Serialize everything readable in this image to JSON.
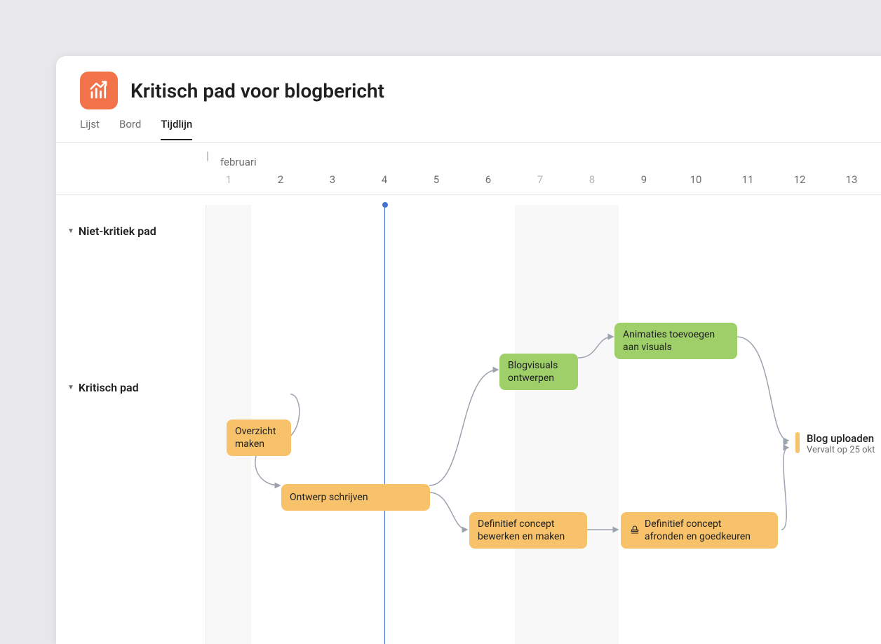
{
  "header": {
    "title": "Kritisch pad voor blogbericht",
    "icon": "growth-chart-icon",
    "accent_color": "#f2734a"
  },
  "tabs": {
    "items": [
      {
        "label": "Lijst",
        "id": "list"
      },
      {
        "label": "Bord",
        "id": "board"
      },
      {
        "label": "Tijdlijn",
        "id": "timeline"
      }
    ],
    "active": "timeline"
  },
  "timeline": {
    "month_label": "februari",
    "today_index": 4,
    "days": [
      1,
      2,
      3,
      4,
      5,
      6,
      7,
      8,
      9,
      10,
      11,
      12,
      13
    ],
    "weekends": [
      [
        1,
        1
      ],
      [
        7,
        8
      ]
    ]
  },
  "sections": [
    {
      "id": "noncritical",
      "label": "Niet-kritiek pad"
    },
    {
      "id": "critical",
      "label": "Kritisch pad"
    }
  ],
  "tasks": {
    "overzicht": {
      "label": "Overzicht\nmaken",
      "color": "orange"
    },
    "ontwerp": {
      "label": "Ontwerp schrijven",
      "color": "orange"
    },
    "blogvisuals": {
      "label": "Blogvisuals\nontwerpen",
      "color": "green"
    },
    "animaties": {
      "label": "Animaties toevoegen\naan visuals",
      "color": "green"
    },
    "defconcept": {
      "label": "Definitief concept\nbewerken en maken",
      "color": "orange"
    },
    "afronden": {
      "label": "Definitief concept\nafronden en goedkeuren",
      "color": "orange",
      "has_approval_icon": true
    },
    "upload": {
      "label": "Blog uploaden",
      "subtitle": "Vervalt op 25 okt",
      "color": "orange"
    }
  },
  "colors": {
    "task_orange": "#f7c26a",
    "task_green": "#9ecf68",
    "today_blue": "#4573d2"
  }
}
